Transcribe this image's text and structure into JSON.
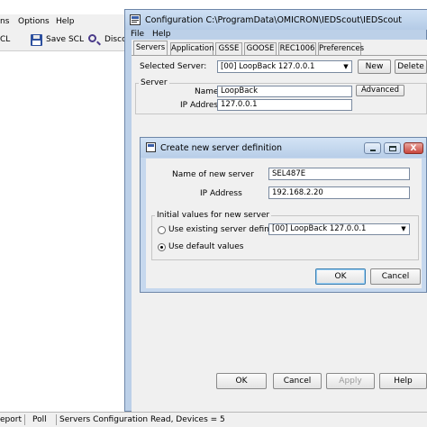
{
  "background_app": {
    "menu": [
      "ns",
      "Options",
      "Help"
    ],
    "toolbar": {
      "btn1": "CL",
      "save_scl": "Save SCL",
      "disco": "Disco"
    },
    "status": {
      "report": "eport",
      "poll": "Poll",
      "message": "Servers Configuration Read, Devices = 5"
    }
  },
  "config_window": {
    "title": "Configuration  C:\\ProgramData\\OMICRON\\IEDScout\\IEDScout",
    "menu": [
      "File",
      "Help"
    ],
    "tabs": [
      "Servers",
      "Application",
      "GSSE",
      "GOOSE",
      "REC1006",
      "Preferences"
    ],
    "active_tab": "Servers",
    "selected_server_label": "Selected Server:",
    "selected_server_value": "[00] LoopBack 127.0.0.1",
    "new_button": "New",
    "delete_button": "Delete",
    "server_group_label": "Server",
    "name_label": "Name",
    "name_value": "LoopBack",
    "ip_label": "IP Address",
    "ip_value": "127.0.0.1",
    "advanced_button": "Advanced",
    "ok_button": "OK",
    "cancel_button": "Cancel",
    "apply_button": "Apply",
    "help_button": "Help"
  },
  "dialog": {
    "title": "Create new server definition",
    "name_label": "Name of new server",
    "name_value": "SEL487E",
    "ip_label": "IP Address",
    "ip_value": "192.168.2.20",
    "group_label": "Initial values for new server",
    "option_existing": "Use existing server definition:",
    "existing_value": "[00] LoopBack 127.0.0.1",
    "option_default": "Use default values",
    "selected_option": "default",
    "ok_button": "OK",
    "cancel_button": "Cancel",
    "close_glyph": "X"
  },
  "colors": {
    "titlebar": "#b4cbe6",
    "close_button": "#c9463d",
    "window_bg": "#f0f0f0"
  }
}
